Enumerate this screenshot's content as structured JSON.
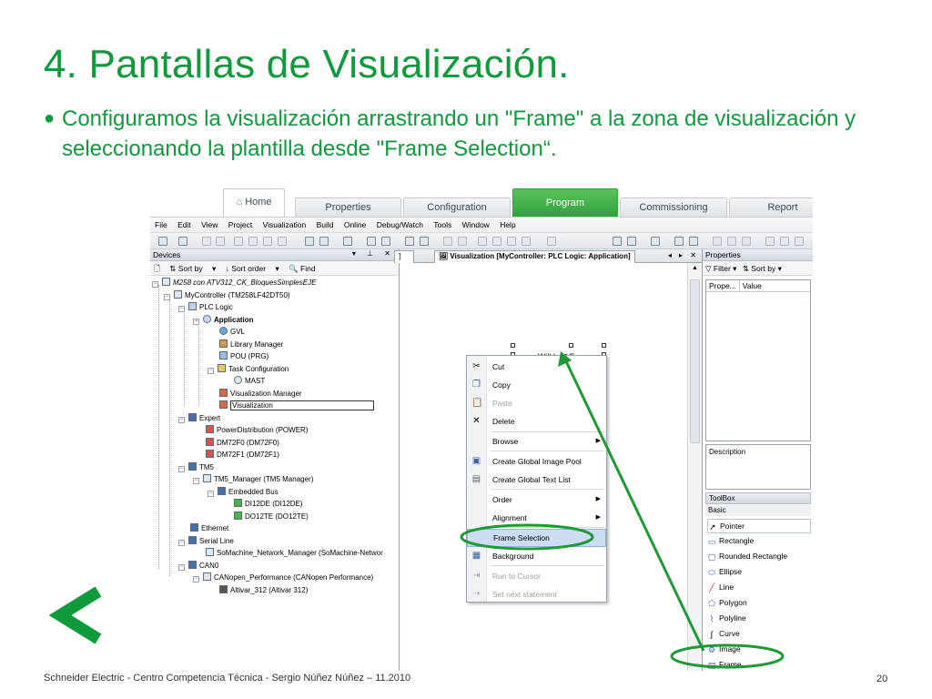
{
  "slide": {
    "title": "4. Pantallas de Visualización.",
    "bullet": "Configuramos la visualización arrastrando un \"Frame\" a la zona de visualización y seleccionando la plantilla desde \"Frame Selection“.",
    "footer": "Schneider Electric - Centro Competencia Técnica - Sergio Núñez Núñez – 11.2010",
    "page_number": "20",
    "accent_color": "#0f9a3c"
  },
  "ribbon": {
    "tabs": [
      "Home",
      "Properties",
      "Configuration",
      "Program",
      "Commissioning",
      "Report"
    ],
    "active_tab": "Program"
  },
  "menu": [
    "File",
    "Edit",
    "View",
    "Project",
    "Visualization",
    "Build",
    "Online",
    "Debug/Watch",
    "Tools",
    "Window",
    "Help"
  ],
  "devices": {
    "title": "Devices",
    "sort_by": "Sort by",
    "sort_order": "Sort order",
    "find": "Find",
    "tree": [
      "M258 con ATV312_CK_BloquesSimplesEJE",
      "MyController (TM258LF42DT50)",
      "PLC Logic",
      "Application",
      "GVL",
      "Library Manager",
      "POU (PRG)",
      "Task Configuration",
      "MAST",
      "Visualization Manager",
      "Visualization",
      "Expert",
      "PowerDistribution (POWER)",
      "DM72F0 (DM72F0)",
      "DM72F1 (DM72F1)",
      "TM5",
      "TM5_Manager (TM5 Manager)",
      "Embedded Bus",
      "DI12DE (DI12DE)",
      "DO12TE (DO12TE)",
      "Ethernet",
      "Serial Line",
      "SoMachine_Network_Manager (SoMachine-Networ",
      "CAN0",
      "CANopen_Performance (CANopen Performance)",
      "Altivar_312 (Altivar 312)"
    ]
  },
  "editor": {
    "left_tab": "]",
    "tab": "Visualization [MyController: PLC Logic: Application]",
    "frame_label": "Will be",
    "frame_label_suffix": "Frame"
  },
  "context_menu": [
    {
      "label": "Cut",
      "icon": "scissors-icon",
      "enabled": true
    },
    {
      "label": "Copy",
      "icon": "copy-icon",
      "enabled": true
    },
    {
      "label": "Paste",
      "icon": "paste-icon",
      "enabled": false
    },
    {
      "label": "Delete",
      "icon": "delete-icon",
      "enabled": true
    },
    {
      "label": "Browse",
      "icon": "",
      "enabled": true,
      "submenu": true
    },
    {
      "label": "Create Global Image Pool",
      "icon": "image-pool-icon",
      "enabled": true
    },
    {
      "label": "Create Global Text List",
      "icon": "text-list-icon",
      "enabled": true
    },
    {
      "label": "Order",
      "icon": "",
      "enabled": true,
      "submenu": true
    },
    {
      "label": "Alignment",
      "icon": "",
      "enabled": true,
      "submenu": true
    },
    {
      "label": "Frame Selection",
      "icon": "",
      "enabled": true,
      "highlighted": true
    },
    {
      "label": "Background",
      "icon": "background-icon",
      "enabled": true
    },
    {
      "label": "Run to Cursor",
      "icon": "run-cursor-icon",
      "enabled": false
    },
    {
      "label": "Set next statement",
      "icon": "next-statement-icon",
      "enabled": false
    }
  ],
  "properties": {
    "title": "Properties",
    "filter": "Filter",
    "sort_by": "Sort by",
    "col_property": "Prope...",
    "col_value": "Value",
    "description": "Description"
  },
  "toolbox": {
    "title": "ToolBox",
    "category": "Basic",
    "items": [
      "Pointer",
      "Rectangle",
      "Rounded Rectangle",
      "Ellipse",
      "Line",
      "Polygon",
      "Polyline",
      "Curve",
      "Image",
      "Frame"
    ]
  }
}
